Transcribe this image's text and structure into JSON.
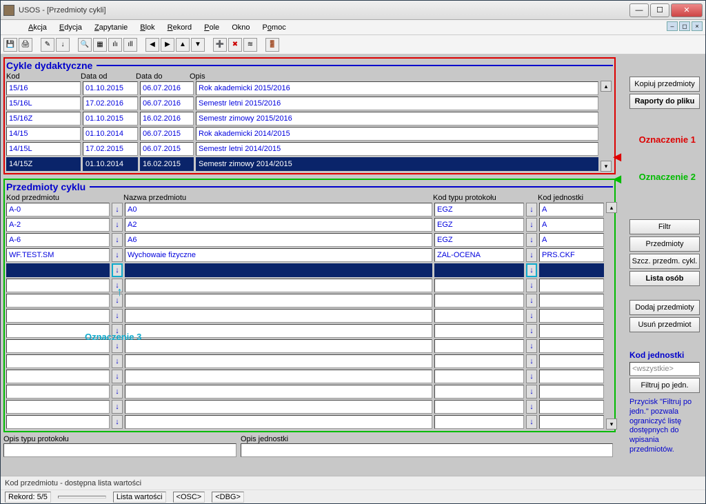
{
  "window": {
    "title": "USOS - [Przedmioty cykli]"
  },
  "menu": {
    "mi0": "Akcja",
    "mi1": "Edycja",
    "mi2": "Zapytanie",
    "mi3": "Blok",
    "mi4": "Rekord",
    "mi5": "Pole",
    "mi6": "Okno",
    "mi7": "Pomoc"
  },
  "cycles": {
    "title": "Cykle dydaktyczne",
    "headers": {
      "kod": "Kod",
      "od": "Data od",
      "do": "Data do",
      "opis": "Opis"
    },
    "rows": [
      {
        "kod": "15/16",
        "od": "01.10.2015",
        "do": "06.07.2016",
        "opis": "Rok akademicki 2015/2016"
      },
      {
        "kod": "15/16L",
        "od": "17.02.2016",
        "do": "06.07.2016",
        "opis": "Semestr letni 2015/2016"
      },
      {
        "kod": "15/16Z",
        "od": "01.10.2015",
        "do": "16.02.2016",
        "opis": "Semestr zimowy 2015/2016"
      },
      {
        "kod": "14/15",
        "od": "01.10.2014",
        "do": "06.07.2015",
        "opis": "Rok akademicki 2014/2015"
      },
      {
        "kod": "14/15L",
        "od": "17.02.2015",
        "do": "06.07.2015",
        "opis": "Semestr letni 2014/2015"
      },
      {
        "kod": "14/15Z",
        "od": "01.10.2014",
        "do": "16.02.2015",
        "opis": "Semestr zimowy 2014/2015"
      }
    ]
  },
  "subjects": {
    "title": "Przedmioty cyklu",
    "headers": {
      "kp": "Kod przedmiotu",
      "np": "Nazwa przedmiotu",
      "kt": "Kod typu protokołu",
      "kj": "Kod jednostki"
    },
    "rows": [
      {
        "kp": "A-0",
        "np": "A0",
        "kt": "EGZ",
        "kj": "A"
      },
      {
        "kp": "A-2",
        "np": "A2",
        "kt": "EGZ",
        "kj": "A"
      },
      {
        "kp": "A-6",
        "np": "A6",
        "kt": "EGZ",
        "kj": "A"
      },
      {
        "kp": "WF.TEST.SM",
        "np": "Wychowaie fizyczne",
        "kt": "ZAL-OCENA",
        "kj": "PRS.CKF"
      }
    ]
  },
  "sidebar": {
    "copy": "Kopiuj przedmioty",
    "reports": "Raporty do pliku",
    "filtr": "Filtr",
    "subjects": "Przedmioty",
    "details": "Szcz. przedm. cykl.",
    "persons": "Lista osób",
    "add": "Dodaj przedmioty",
    "del": "Usuń przedmiot",
    "unit_label": "Kod jednostki",
    "unit_value": "<wszystkie>",
    "filter_unit": "Filtruj po jedn.",
    "note": "Przycisk \"Filtruj po jedn.\" pozwala ograniczyć listę dostępnych do wpisania przedmiotów."
  },
  "annot": {
    "a1": "Oznaczenie 1",
    "a2": "Oznaczenie 2",
    "a3": "Oznaczenie 3"
  },
  "footer": {
    "otp": "Opis typu protokołu",
    "oj": "Opis jednostki"
  },
  "status": {
    "s1": "Kod przedmiotu - dostępna lista wartości",
    "rec": "Rekord: 5/5",
    "lw": "Lista wartości",
    "osc": "<OSC>",
    "dbg": "<DBG>"
  }
}
